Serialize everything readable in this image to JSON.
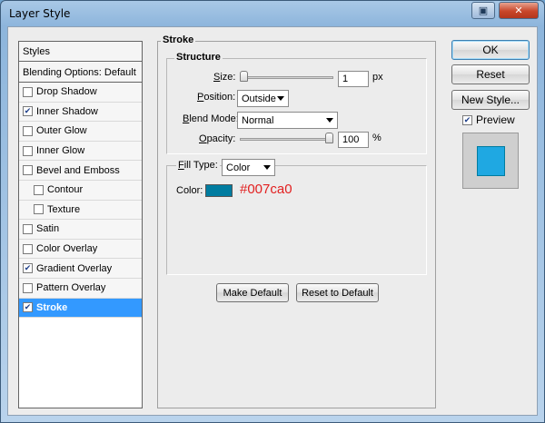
{
  "window": {
    "title": "Layer Style"
  },
  "colors": {
    "stroke_color": "#007ca0",
    "preview_fill": "#1fa8e2",
    "hex_annotation": "#e22020",
    "selected": "#3399ff"
  },
  "styles_panel": {
    "header": "Styles",
    "blending_options": "Blending Options: Default",
    "items": [
      {
        "label": "Drop Shadow",
        "checked": false,
        "sub": false,
        "selected": false
      },
      {
        "label": "Inner Shadow",
        "checked": true,
        "sub": false,
        "selected": false
      },
      {
        "label": "Outer Glow",
        "checked": false,
        "sub": false,
        "selected": false
      },
      {
        "label": "Inner Glow",
        "checked": false,
        "sub": false,
        "selected": false
      },
      {
        "label": "Bevel and Emboss",
        "checked": false,
        "sub": false,
        "selected": false
      },
      {
        "label": "Contour",
        "checked": false,
        "sub": true,
        "selected": false
      },
      {
        "label": "Texture",
        "checked": false,
        "sub": true,
        "selected": false
      },
      {
        "label": "Satin",
        "checked": false,
        "sub": false,
        "selected": false
      },
      {
        "label": "Color Overlay",
        "checked": false,
        "sub": false,
        "selected": false
      },
      {
        "label": "Gradient Overlay",
        "checked": true,
        "sub": false,
        "selected": false
      },
      {
        "label": "Pattern Overlay",
        "checked": false,
        "sub": false,
        "selected": false
      },
      {
        "label": "Stroke",
        "checked": true,
        "sub": false,
        "selected": true
      }
    ]
  },
  "stroke": {
    "group_title": "Stroke",
    "structure_title": "Structure",
    "size": {
      "label": "Size:",
      "value": "1",
      "unit": "px",
      "level": 0.0
    },
    "position": {
      "label": "Position:",
      "value": "Outside"
    },
    "blend_mode": {
      "label": "Blend Mode:",
      "value": "Normal"
    },
    "opacity": {
      "label": "Opacity:",
      "value": "100",
      "unit": "%",
      "level": 1.0
    },
    "fill_type": {
      "label": "Fill Type:",
      "value": "Color"
    },
    "color": {
      "label": "Color:",
      "annotation": "#007ca0"
    },
    "make_default": "Make Default",
    "reset_default": "Reset to Default"
  },
  "actions": {
    "ok": "OK",
    "reset": "Reset",
    "new_style": "New Style...",
    "preview_label": "Preview",
    "preview_checked": true
  }
}
